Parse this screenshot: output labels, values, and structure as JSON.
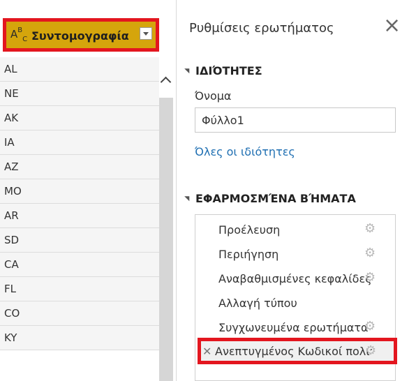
{
  "grid": {
    "column": {
      "type_icon": {
        "a": "A",
        "b": "B",
        "c": "C"
      },
      "name": "Συντομογραφία"
    },
    "rows": [
      "AL",
      "NE",
      "AK",
      "IA",
      "AZ",
      "MO",
      "AR",
      "SD",
      "CA",
      "FL",
      "CO",
      "KY"
    ]
  },
  "panel": {
    "title": "Ρυθμίσεις ερωτήματος",
    "close_glyph": "×",
    "properties": {
      "heading": "ΙΔΙΌΤΗΤΕΣ",
      "name_label": "Όνομα",
      "name_value": "Φύλλο1",
      "all_properties_link": "Όλες οι ιδιότητες"
    },
    "applied_steps": {
      "heading": "ΕΦΑΡΜΟΣΜΈΝΑ ΒΉΜΑΤΑ",
      "steps": [
        {
          "label": "Προέλευση",
          "gear": true
        },
        {
          "label": "Περιήγηση",
          "gear": true
        },
        {
          "label": "Αναβαθμισμένες κεφαλίδες",
          "gear": true
        },
        {
          "label": "Αλλαγή τύπου",
          "gear": false
        },
        {
          "label": "Συγχωνευμένα ερωτήματα",
          "gear": true
        },
        {
          "label": "Ανεπτυγμένος Κωδικοί πολιτ...",
          "gear": true,
          "selected": true
        }
      ]
    }
  },
  "colors": {
    "highlight": "#e3161f",
    "header_fill": "#d5a50c",
    "link": "#1f6fb2"
  }
}
